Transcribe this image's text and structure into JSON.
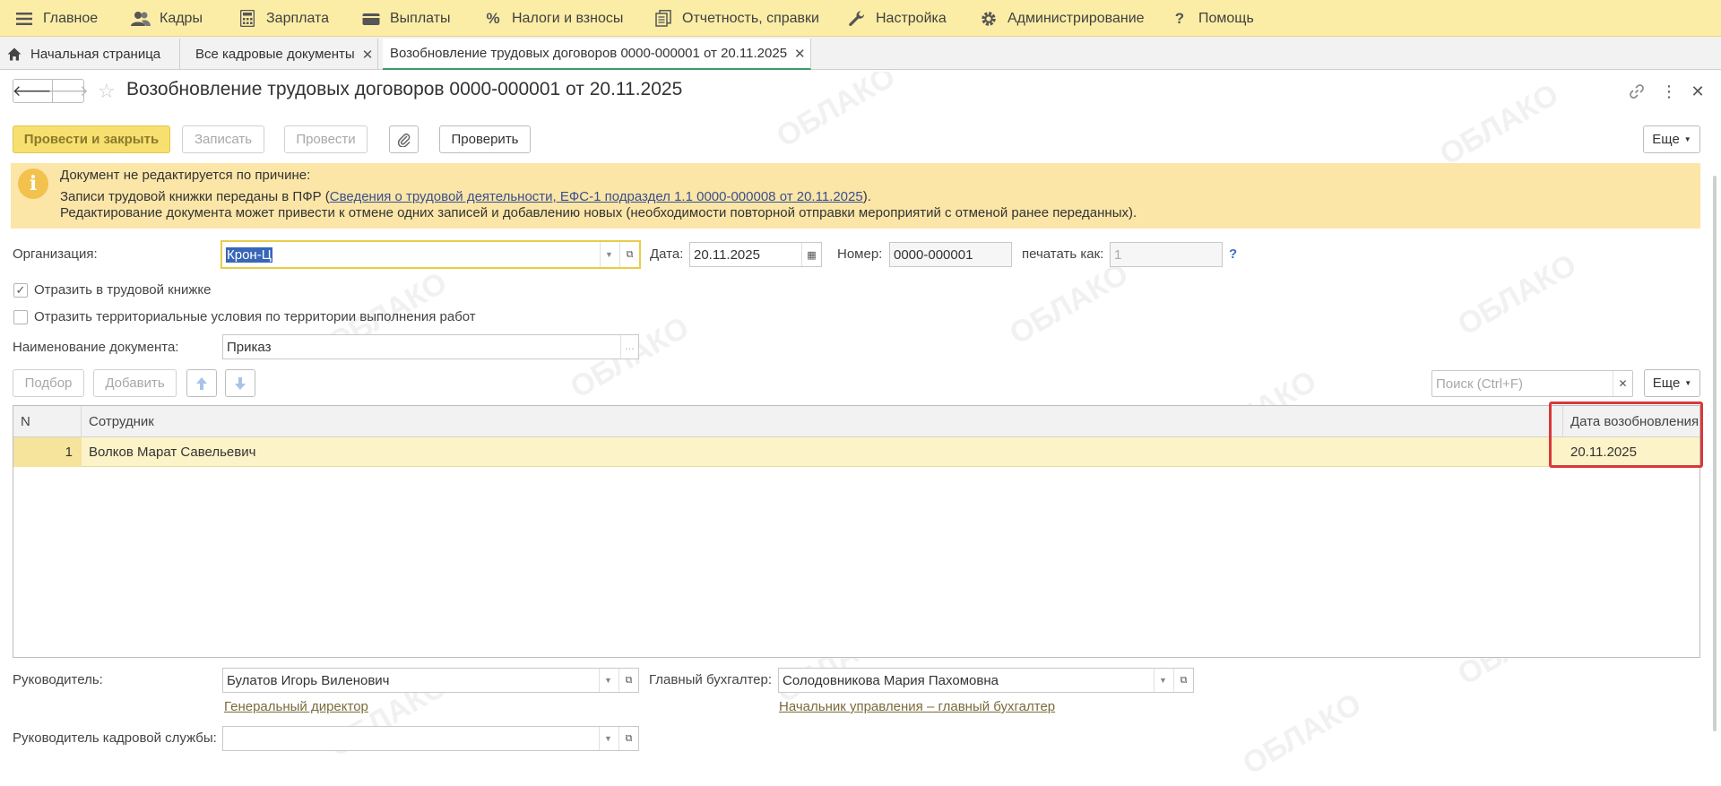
{
  "menu": {
    "items": [
      {
        "label": "Главное",
        "icon": "hamburger-icon"
      },
      {
        "label": "Кадры",
        "icon": "people-icon"
      },
      {
        "label": "Зарплата",
        "icon": "calculator-icon"
      },
      {
        "label": "Выплаты",
        "icon": "wallet-icon"
      },
      {
        "label": "Налоги и взносы",
        "icon": "percent-icon"
      },
      {
        "label": "Отчетность, справки",
        "icon": "reports-icon"
      },
      {
        "label": "Настройка",
        "icon": "wrench-icon"
      },
      {
        "label": "Администрирование",
        "icon": "gear-icon"
      },
      {
        "label": "Помощь",
        "icon": "question-icon"
      }
    ]
  },
  "tabs": [
    {
      "label": "Начальная страница"
    },
    {
      "label": "Все кадровые документы"
    },
    {
      "label": "Возобновление трудовых договоров 0000-000001 от 20.11.2025"
    }
  ],
  "doc": {
    "title": "Возобновление трудовых договоров 0000-000001 от 20.11.2025"
  },
  "toolbar": {
    "post_close": "Провести и закрыть",
    "save": "Записать",
    "post": "Провести",
    "check": "Проверить",
    "more": "Еще"
  },
  "warning": {
    "line1": "Документ не редактируется по причине:",
    "line2_prefix": "Записи трудовой книжки переданы в ПФР (",
    "line2_link": "Сведения о трудовой деятельности, ЕФС-1 подраздел 1.1 0000-000008 от 20.11.2025",
    "line2_suffix": ").",
    "line3": "Редактирование документа может привести к отмене одних записей и добавлению новых (необходимости повторной отправки мероприятий с отменой ранее переданных)."
  },
  "form": {
    "org_label": "Организация:",
    "org_value": "Крон-Ц",
    "date_label": "Дата:",
    "date_value": "20.11.2025",
    "number_label": "Номер:",
    "number_value": "0000-000001",
    "print_as_label": "печатать как:",
    "print_as_value": "1",
    "help": "?",
    "reflect_book_label": "Отразить в трудовой книжке",
    "reflect_book_checked": true,
    "reflect_terr_label": "Отразить территориальные условия по территории выполнения работ",
    "reflect_terr_checked": false,
    "docname_label": "Наименование документа:",
    "docname_value": "Приказ"
  },
  "table_toolbar": {
    "pick": "Подбор",
    "add": "Добавить",
    "search_placeholder": "Поиск (Ctrl+F)",
    "more": "Еще"
  },
  "table": {
    "columns": [
      "N",
      "Сотрудник",
      "Дата возобновления"
    ],
    "rows": [
      {
        "n": "1",
        "employee": "Волков Марат Савельевич",
        "date": "20.11.2025"
      }
    ]
  },
  "footer": {
    "head_label": "Руководитель:",
    "head_value": "Булатов Игорь Виленович",
    "head_position": "Генеральный директор",
    "accountant_label": "Главный бухгалтер:",
    "accountant_value": "Солодовникова Мария Пахомовна",
    "accountant_position": "Начальник управления – главный бухгалтер",
    "hr_label": "Руководитель кадровой службы:",
    "hr_value": ""
  },
  "colors": {
    "menu_bg": "#fbeda6",
    "warning_bg": "#fbe6a8",
    "highlight_border": "#d9383a",
    "row_bg": "#fdf3c8",
    "primary_btn": "#f7e070"
  }
}
